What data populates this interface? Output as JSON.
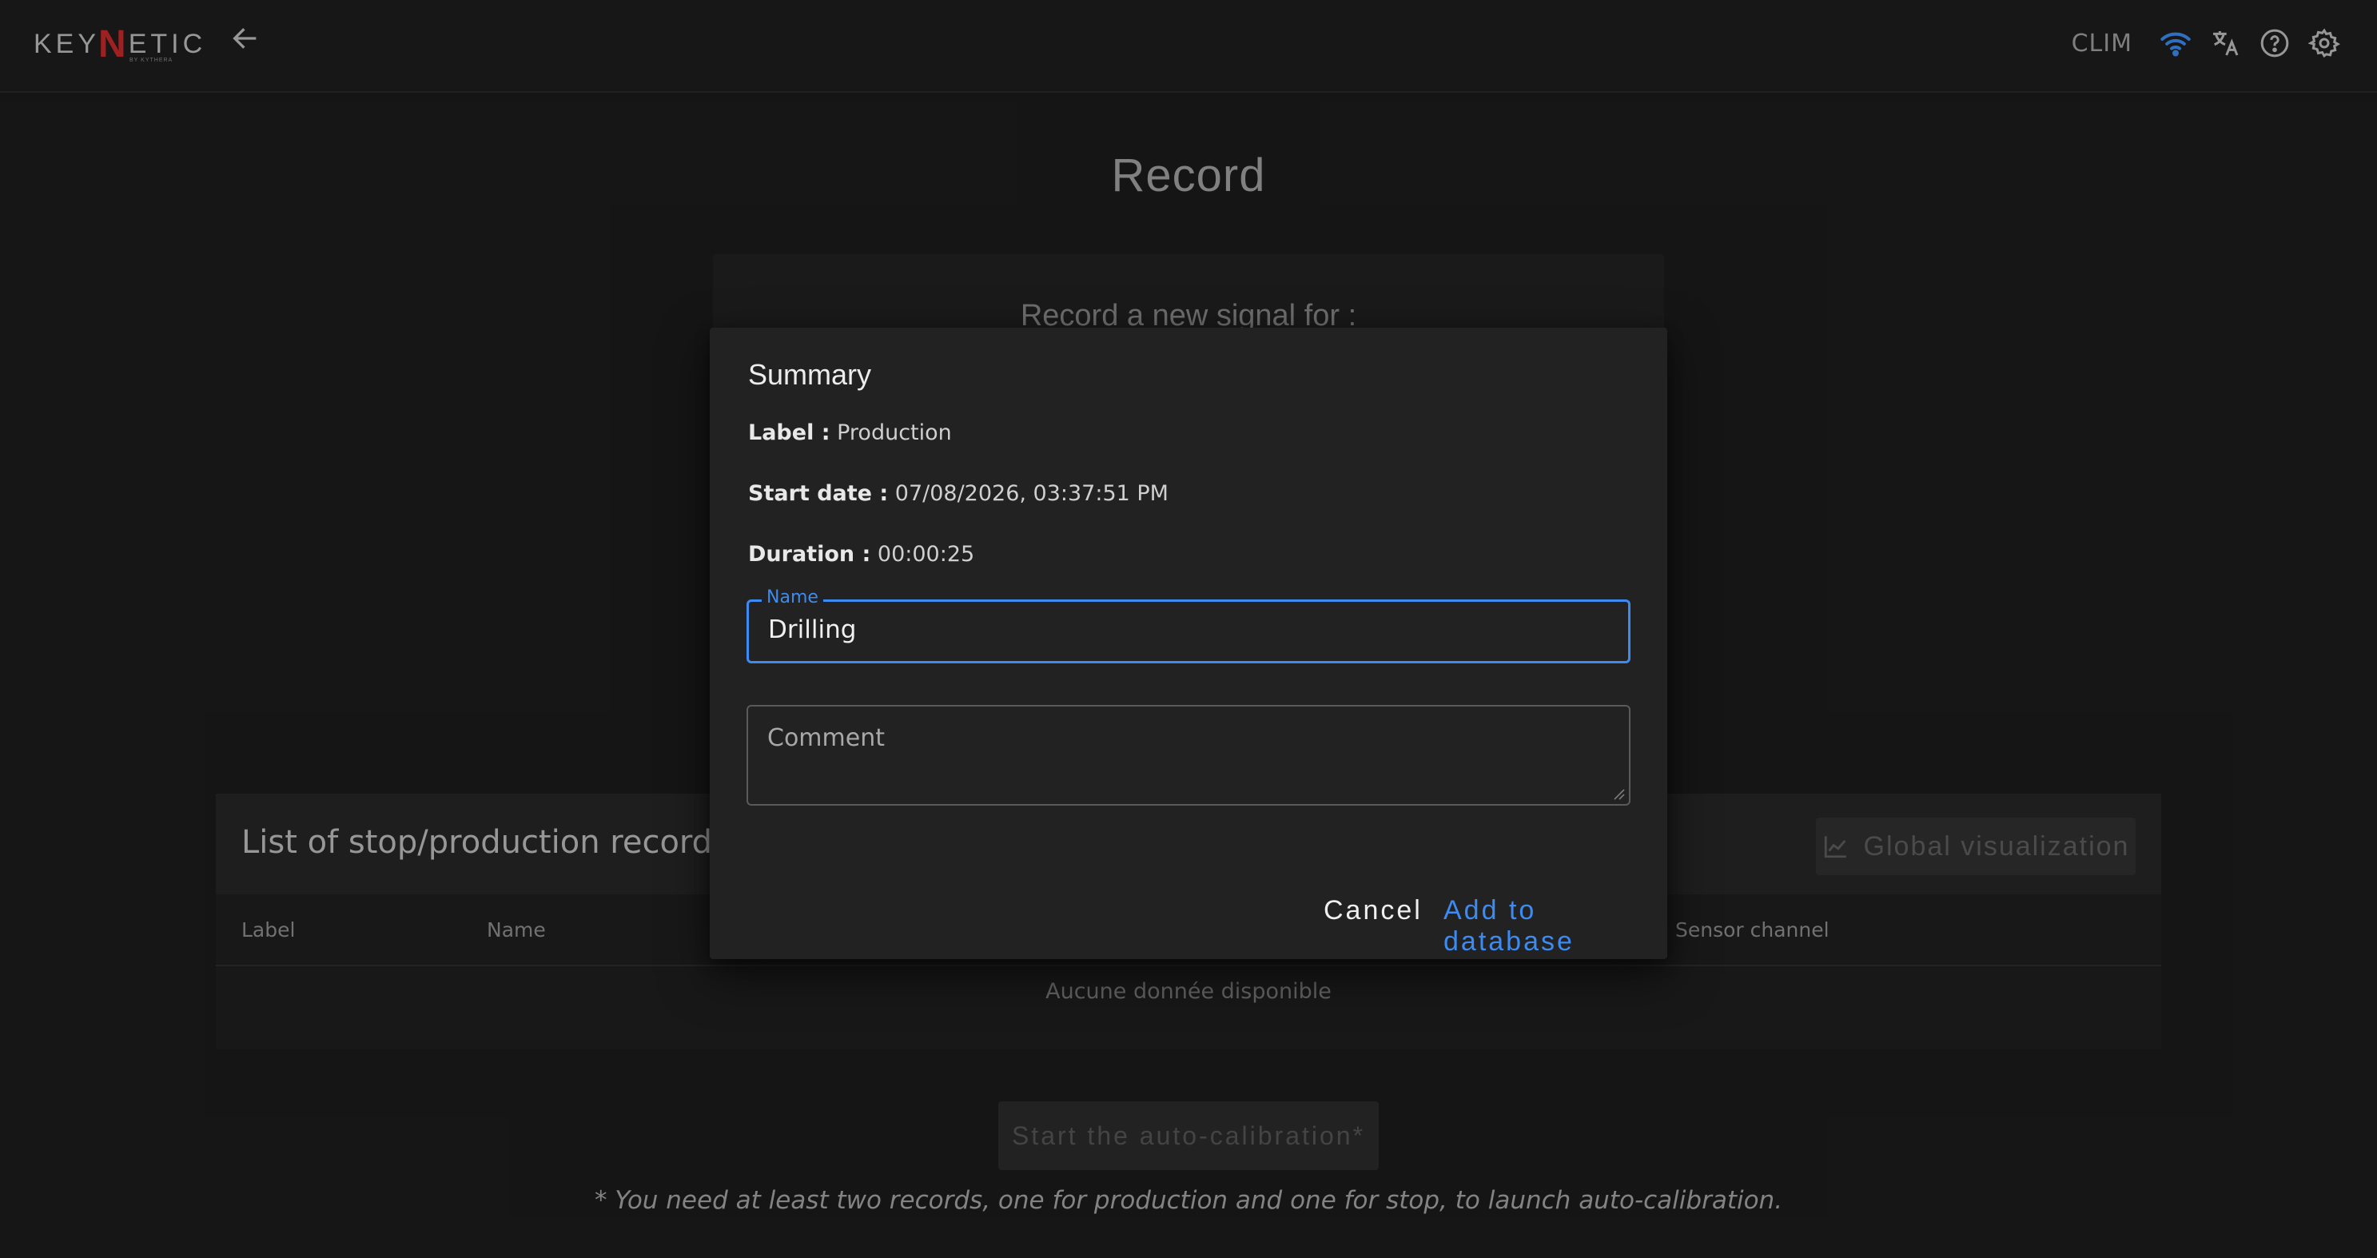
{
  "topbar": {
    "logo_text_left": "KEY",
    "logo_mark": "N",
    "logo_text_right": "ETIC",
    "logo_sub": "BY KYTHERA",
    "device_name": "CLIM",
    "icons": [
      "back-arrow-icon",
      "wifi-icon",
      "translate-icon",
      "help-icon",
      "gear-icon"
    ],
    "accent_color": "#3d8bf0"
  },
  "page": {
    "title": "Record",
    "record_card_subtitle": "Record a new signal for :"
  },
  "records": {
    "title": "List of stop/production records",
    "global_visualization_label": "Global visualization",
    "columns": [
      "Label",
      "Name",
      "Sensor channel"
    ],
    "empty_text": "Aucune donnée disponible"
  },
  "calibration": {
    "button_label": "Start the auto-calibration*",
    "footnote": "* You need at least two records, one for production and one for stop, to launch auto-calibration."
  },
  "dialog": {
    "title": "Summary",
    "label_key": "Label :",
    "label_value": "Production",
    "start_key": "Start date :",
    "start_value": "07/08/2026, 03:37:51 PM",
    "duration_key": "Duration :",
    "duration_value": "00:00:25",
    "name_field_label": "Name",
    "name_field_value": "Drilling",
    "comment_placeholder": "Comment",
    "cancel_label": "Cancel",
    "add_label": "Add to database"
  }
}
